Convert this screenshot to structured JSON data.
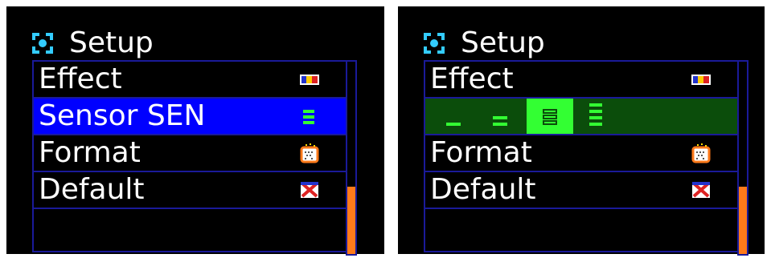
{
  "screens": [
    {
      "title": "Setup",
      "title_icon": "setup-icon",
      "items": [
        {
          "label": "Effect",
          "icon": "effect-flag-icon"
        },
        {
          "label": "Sensor SEN",
          "icon": "sensitivity-bars-icon",
          "selected": true
        },
        {
          "label": "Format",
          "icon": "format-card-icon"
        },
        {
          "label": "Default",
          "icon": "default-reset-icon"
        },
        {
          "label": "",
          "icon": ""
        }
      ],
      "scroll_position": 0.35
    },
    {
      "title": "Setup",
      "title_icon": "setup-icon",
      "items": [
        {
          "label": "Effect",
          "icon": "effect-flag-icon"
        },
        {
          "label": "",
          "icon": "sensitivity-level-selector",
          "editing": true
        },
        {
          "label": "Format",
          "icon": "format-card-icon"
        },
        {
          "label": "Default",
          "icon": "default-reset-icon"
        },
        {
          "label": "",
          "icon": ""
        }
      ],
      "sensitivity_levels": 4,
      "sensitivity_selected": 3,
      "scroll_position": 0.35
    }
  ],
  "colors": {
    "background": "#000000",
    "border": "#1a1a99",
    "selected_row": "#0000ff",
    "editing_row": "#0b4d0b",
    "level_active": "#33ff33",
    "scroll_thumb": "#ff7a1a",
    "title_icon": "#33ccff"
  }
}
